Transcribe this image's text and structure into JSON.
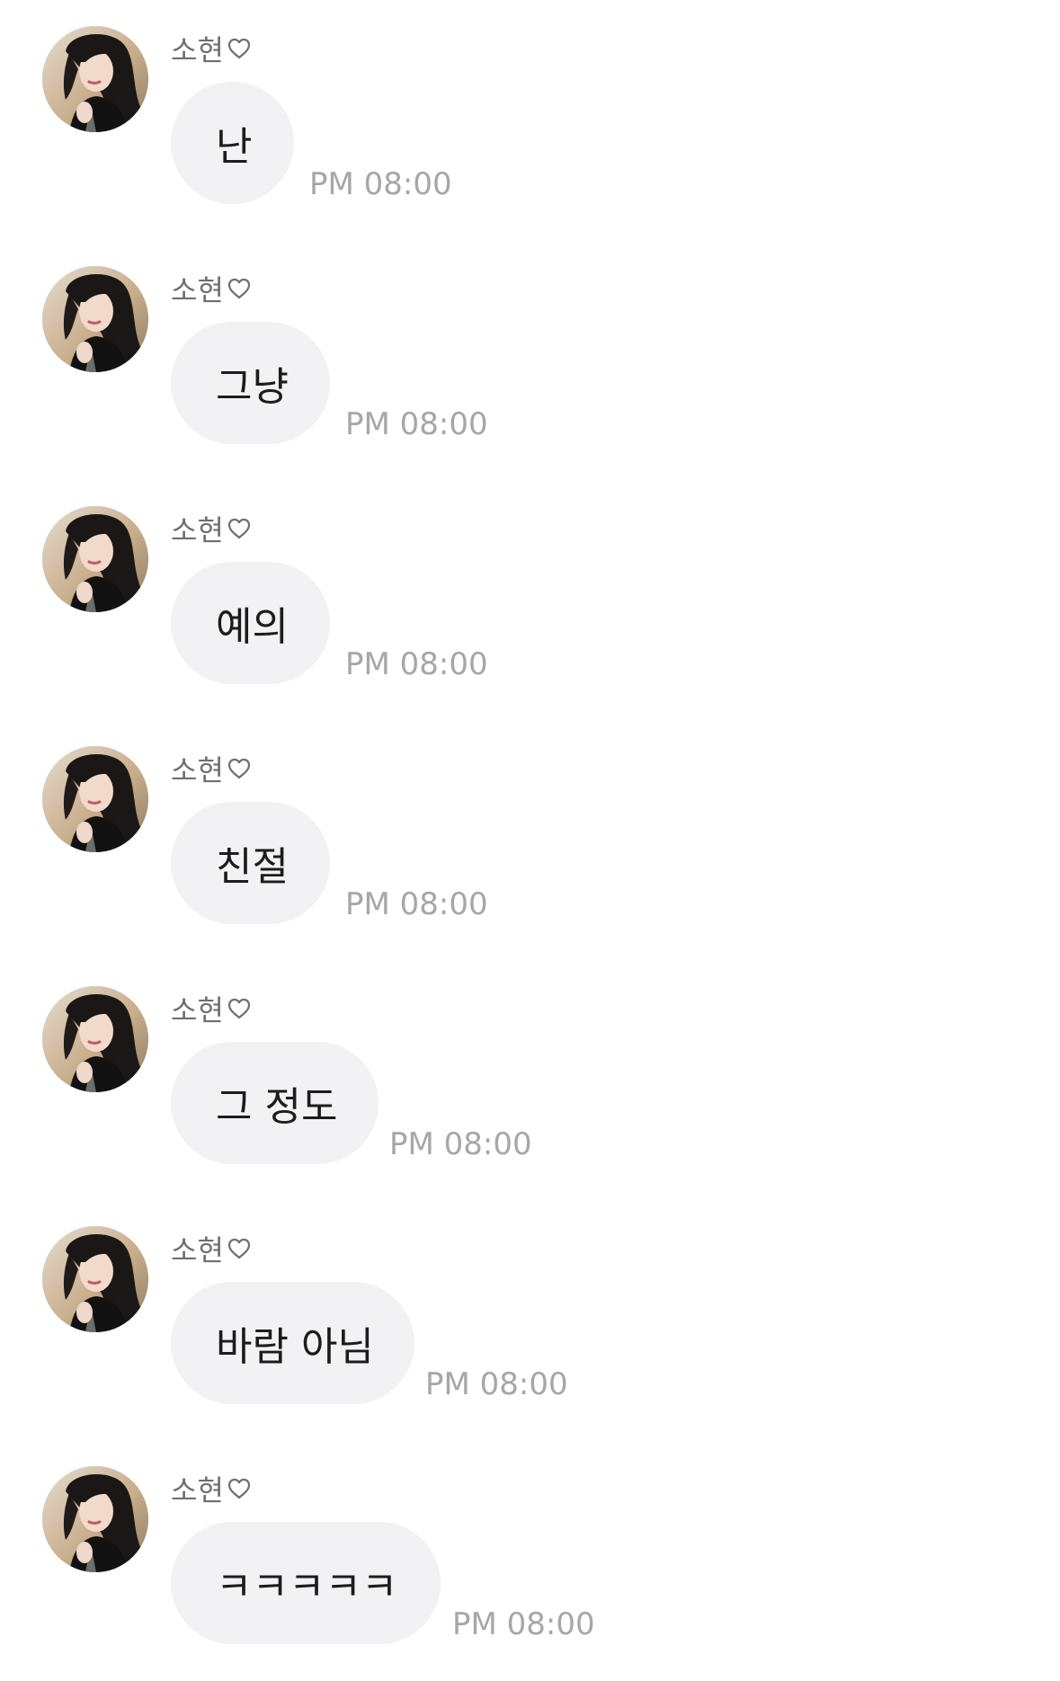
{
  "messages": [
    {
      "sender": "소현",
      "text": "난",
      "time": "PM 08:00"
    },
    {
      "sender": "소현",
      "text": "그냥",
      "time": "PM 08:00"
    },
    {
      "sender": "소현",
      "text": "예의",
      "time": "PM 08:00"
    },
    {
      "sender": "소현",
      "text": "친절",
      "time": "PM 08:00"
    },
    {
      "sender": "소현",
      "text": "그 정도",
      "time": "PM 08:00"
    },
    {
      "sender": "소현",
      "text": "바람 아님",
      "time": "PM 08:00"
    },
    {
      "sender": "소현",
      "text": "ㅋㅋㅋㅋㅋ",
      "time": "PM 08:00"
    }
  ],
  "icons": {
    "sender_suffix": "heart-outline-icon",
    "avatar": "profile-photo"
  },
  "colors": {
    "background": "#ffffff",
    "bubble": "#f2f2f4",
    "message_text": "#1c1c1c",
    "sender_text": "#6f6f6f",
    "timestamp_text": "#a6a6ab"
  }
}
